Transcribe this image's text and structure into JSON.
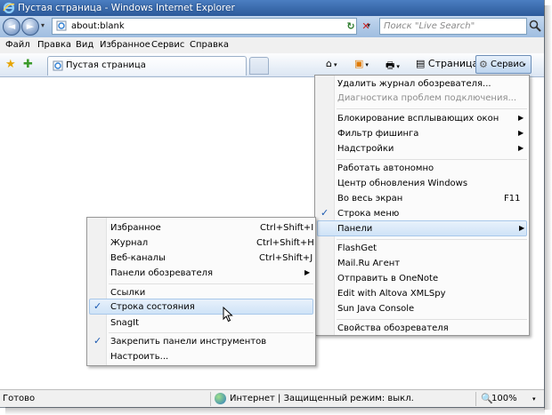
{
  "window": {
    "title": "Пустая страница - Windows Internet Explorer"
  },
  "nav": {
    "back_glyph": "◄",
    "forward_glyph": "►",
    "address": "about:blank",
    "refresh_glyph": "↻",
    "stop_glyph": "✕",
    "search_placeholder": "Поиск \"Live Search\""
  },
  "menubar": {
    "items": [
      "Файл",
      "Правка",
      "Вид",
      "Избранное",
      "Сервис",
      "Справка"
    ]
  },
  "command_bar": {
    "tab_label": "Пустая страница",
    "page_label": "Страница",
    "tools_label": "Сервис",
    "arrow": "▾"
  },
  "tools_menu": {
    "items": [
      {
        "label": "Удалить журнал обозревателя..."
      },
      {
        "label": "Диагностика проблем подключения...",
        "disabled": true
      },
      {
        "label": "Блокирование всплывающих окон",
        "submenu": true
      },
      {
        "label": "Фильтр фишинга",
        "submenu": true
      },
      {
        "label": "Надстройки",
        "submenu": true
      },
      {
        "label": "Работать автономно"
      },
      {
        "label": "Центр обновления Windows"
      },
      {
        "label": "Во весь экран",
        "shortcut": "F11"
      },
      {
        "label": "Строка меню",
        "checked": true
      },
      {
        "label": "Панели",
        "submenu": true,
        "highlighted": true
      },
      {
        "label": "FlashGet"
      },
      {
        "label": "Mail.Ru Агент"
      },
      {
        "label": "Отправить в OneNote"
      },
      {
        "label": "Edit with Altova XMLSpy"
      },
      {
        "label": "Sun Java Console"
      },
      {
        "label": "Свойства обозревателя"
      }
    ]
  },
  "toolbars_submenu": {
    "items": [
      {
        "label": "Избранное",
        "shortcut": "Ctrl+Shift+I"
      },
      {
        "label": "Журнал",
        "shortcut": "Ctrl+Shift+H"
      },
      {
        "label": "Веб-каналы",
        "shortcut": "Ctrl+Shift+J"
      },
      {
        "label": "Панели обозревателя",
        "submenu": true
      },
      {
        "label": "Ссылки"
      },
      {
        "label": "Строка состояния",
        "checked": true,
        "highlighted": true
      },
      {
        "label": "SnagIt"
      },
      {
        "label": "Закрепить панели инструментов",
        "checked": true
      },
      {
        "label": "Настроить..."
      }
    ]
  },
  "glyphs": {
    "check": "✓",
    "submenu_arrow": "▶"
  },
  "status": {
    "ready": "Готово",
    "zone": "Интернет | Защищенный режим: выкл.",
    "zoom": "100%"
  },
  "colors": {
    "accent": "#2c5a9a",
    "highlight": "#cfe3f7"
  }
}
